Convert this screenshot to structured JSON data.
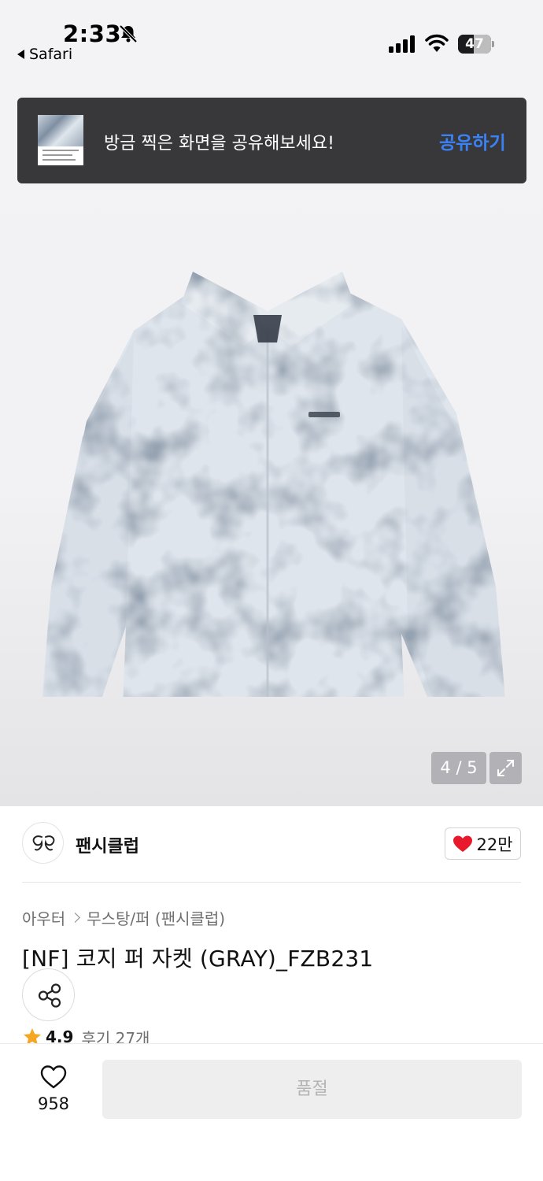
{
  "status_bar": {
    "time": "2:33",
    "back_app": "Safari",
    "battery": "47",
    "battery_level": 0.47,
    "icons": [
      "bell-slash-icon",
      "cellular-signal-icon",
      "wifi-icon",
      "battery-icon"
    ]
  },
  "toast": {
    "message": "방금 찍은 화면을 공유해보세요!",
    "action": "공유하기",
    "action_color": "#3b82f6"
  },
  "gallery": {
    "counter": "4 / 5",
    "icons": [
      "expand-icon"
    ]
  },
  "store": {
    "name": "팬시클럽",
    "likes": "22만",
    "icons": [
      "store-logo-icon",
      "heart-filled-icon"
    ]
  },
  "product": {
    "breadcrumb": [
      "아우터",
      "무스탕/퍼 (팬시클럽)"
    ],
    "title": "[NF] 코지 퍼 자켓 (GRAY)_FZB231",
    "rating": "4.9",
    "review_count": "후기 27개",
    "icons": [
      "share-icon",
      "star-icon"
    ]
  },
  "bottom_bar": {
    "wish_count": "958",
    "buy_label": "품절",
    "icons": [
      "heart-outline-icon"
    ]
  },
  "colors": {
    "accent_blue": "#3b82f6",
    "like_red": "#e8192c",
    "star_orange": "#f5a623",
    "toast_bg": "#38383a"
  }
}
